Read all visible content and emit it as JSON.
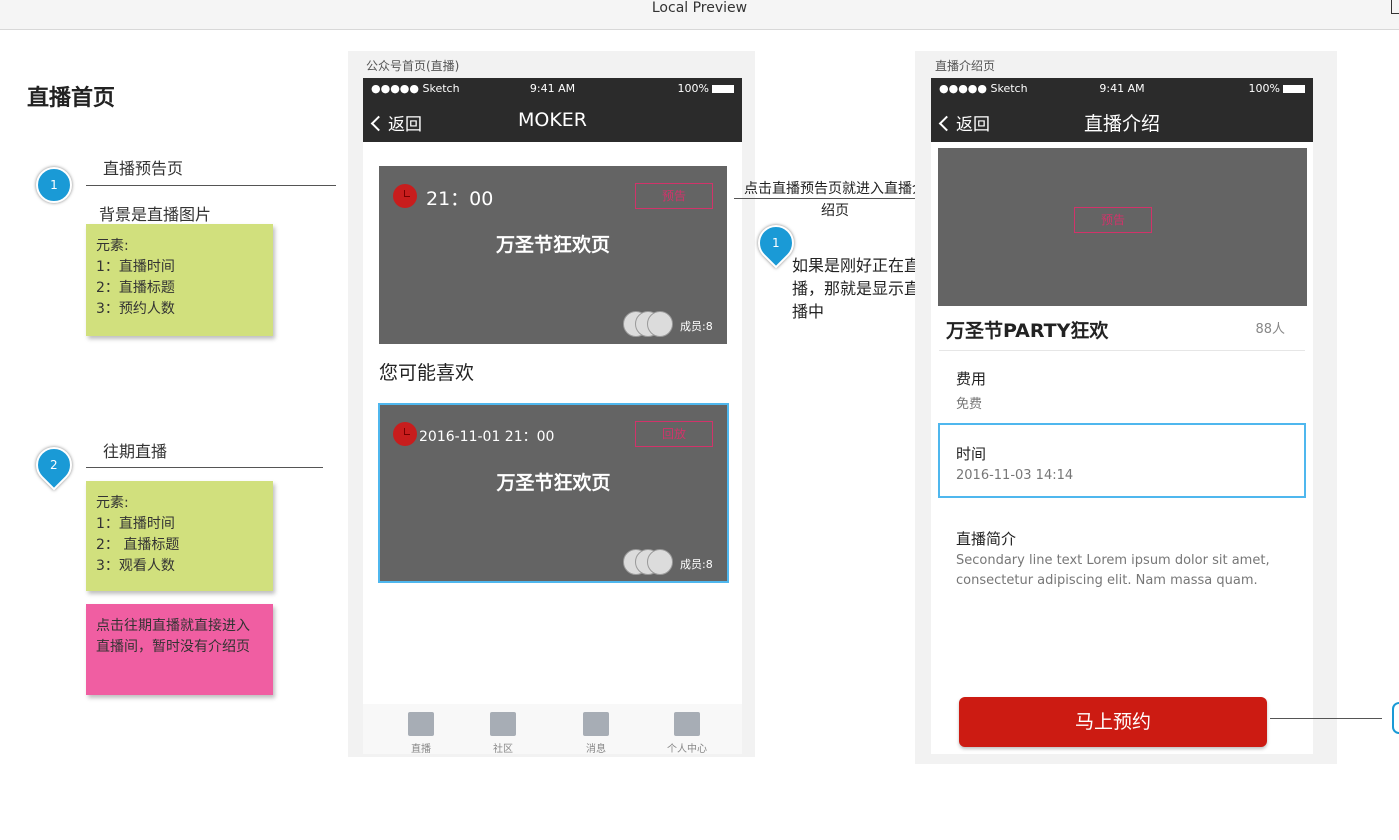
{
  "window": {
    "title": "Local Preview"
  },
  "left": {
    "page_title": "直播首页",
    "annotation1": {
      "marker": "1",
      "label": "直播预告页",
      "subtitle": "背景是直播图片",
      "note_lines": [
        "元素:",
        "1：直播时间",
        "2：直播标题",
        "3：预约人数"
      ]
    },
    "annotation2": {
      "marker": "2",
      "label": "往期直播",
      "note_lines": [
        "元素:",
        "1：直播时间",
        "2：  直播标题",
        "3：观看人数"
      ],
      "pink_note": "点击往期直播就直接进入直播间，暂时没有介绍页"
    }
  },
  "phone1": {
    "caption": "公众号首页(直播)",
    "status": {
      "carrier": "●●●●● Sketch",
      "time": "9:41 AM",
      "battery": "100%"
    },
    "nav": {
      "back": "返回",
      "title": "MOKER"
    },
    "card1": {
      "time": "21：00",
      "badge": "预告",
      "title": "万圣节狂欢页",
      "members": "成员:8"
    },
    "section_title": "您可能喜欢",
    "card2": {
      "time": "2016-11-01 21：00",
      "badge": "回放",
      "title": "万圣节狂欢页",
      "members": "成员:8"
    },
    "tabs": [
      {
        "label": "直播",
        "icon": "live-icon"
      },
      {
        "label": "社区",
        "icon": "community-icon"
      },
      {
        "label": "消息",
        "icon": "message-icon"
      },
      {
        "label": "个人中心",
        "icon": "profile-icon"
      }
    ]
  },
  "middle": {
    "connector_text": "点击直播预告页就进入直播介绍页",
    "marker": "1",
    "note": "如果是刚好正在直播，那就是显示直播中"
  },
  "phone2": {
    "caption": "直播介绍页",
    "status": {
      "carrier": "●●●●● Sketch",
      "time": "9:41 AM",
      "battery": "100%"
    },
    "nav": {
      "back": "返回",
      "title": "直播介绍"
    },
    "banner_badge": "预告",
    "event_title": "万圣节PARTY狂欢",
    "count": "88人",
    "fee_label": "费用",
    "fee_value": "免费",
    "time_label": "时间",
    "time_value": "2016-11-03 14:14",
    "intro_label": "直播简介",
    "intro_text": "Secondary line text Lorem ipsum dolor sit amet, consectetur adipiscing elit. Nam massa quam.",
    "cta": "马上预约"
  },
  "colors": {
    "accent_blue": "#1a9ad6",
    "note_green": "#d1e07d",
    "note_pink": "#f05ea2",
    "cta_red": "#cc1b12",
    "selected_border": "#4fb7ee"
  }
}
